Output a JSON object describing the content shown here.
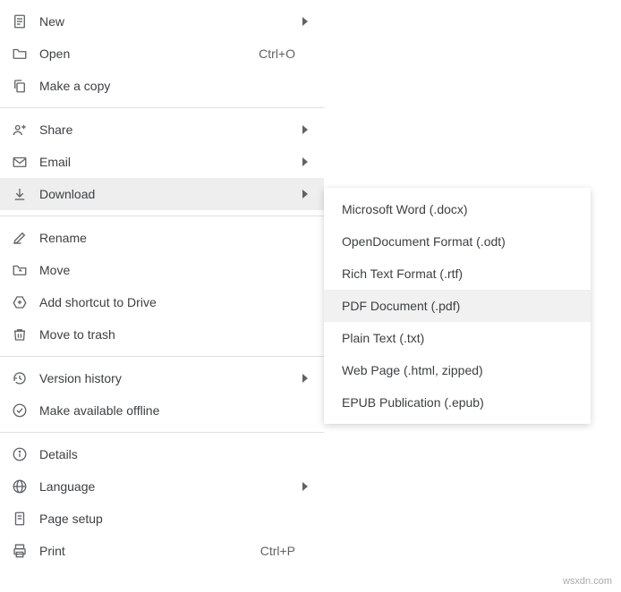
{
  "menu": {
    "items": [
      {
        "label": "New",
        "arrow": true
      },
      {
        "label": "Open",
        "shortcut": "Ctrl+O"
      },
      {
        "label": "Make a copy"
      }
    ],
    "group2": [
      {
        "label": "Share",
        "arrow": true
      },
      {
        "label": "Email",
        "arrow": true
      },
      {
        "label": "Download",
        "arrow": true,
        "hovered": true
      }
    ],
    "group3": [
      {
        "label": "Rename"
      },
      {
        "label": "Move"
      },
      {
        "label": "Add shortcut to Drive"
      },
      {
        "label": "Move to trash"
      }
    ],
    "group4": [
      {
        "label": "Version history",
        "arrow": true
      },
      {
        "label": "Make available offline"
      }
    ],
    "group5": [
      {
        "label": "Details"
      },
      {
        "label": "Language",
        "arrow": true
      },
      {
        "label": "Page setup"
      },
      {
        "label": "Print",
        "shortcut": "Ctrl+P"
      }
    ]
  },
  "submenu": {
    "items": [
      {
        "label": "Microsoft Word (.docx)"
      },
      {
        "label": "OpenDocument Format (.odt)"
      },
      {
        "label": "Rich Text Format (.rtf)"
      },
      {
        "label": "PDF Document (.pdf)",
        "hovered": true
      },
      {
        "label": "Plain Text (.txt)"
      },
      {
        "label": "Web Page (.html, zipped)"
      },
      {
        "label": "EPUB Publication (.epub)"
      }
    ]
  },
  "watermark": "wsxdn.com"
}
